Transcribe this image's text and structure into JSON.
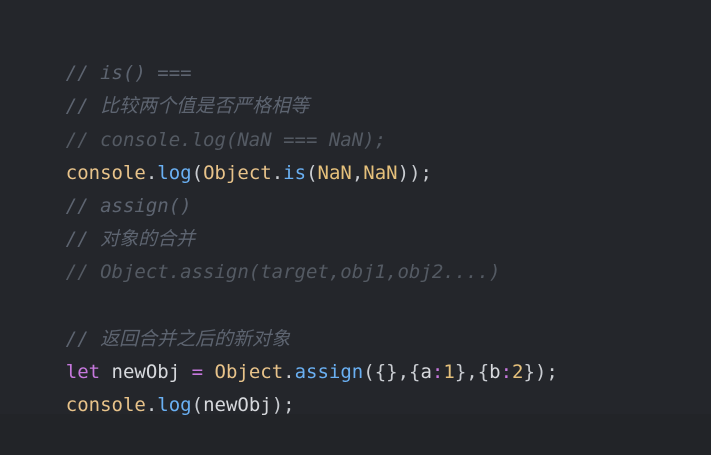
{
  "lines": {
    "l1": "// is() ===",
    "l2": "// 比较两个值是否严格相等",
    "l3": "// console.log(NaN === NaN);",
    "l4": {
      "a": "console",
      "b": ".",
      "c": "log",
      "d": "(",
      "e": "Object",
      "f": ".",
      "g": "is",
      "h": "(",
      "i": "NaN",
      "j": ",",
      "k": "NaN",
      "l": "));"
    },
    "l5": "// assign()",
    "l6": "// 对象的合并",
    "l7": "// Object.assign(target,obj1,obj2....)",
    "l9": "// 返回合并之后的新对象",
    "l10": {
      "a": "let",
      "b": " newObj ",
      "c": "=",
      "d": " ",
      "e": "Object",
      "f": ".",
      "g": "assign",
      "h": "({},{",
      "i": "a",
      "j": ":",
      "k": "1",
      "l": "},{",
      "m": "b",
      "n": ":",
      "o": "2",
      "p": "});"
    },
    "l11": {
      "a": "console",
      "b": ".",
      "c": "log",
      "d": "(",
      "e": "newObj",
      "f": ");"
    }
  },
  "colors": {
    "background": "#24262b",
    "comment": "#5d6470",
    "identifier": "#d7d9dd",
    "function": "#6ab0f3",
    "object": "#e8c38a",
    "keyword": "#c678dd",
    "number": "#e5c07b"
  }
}
